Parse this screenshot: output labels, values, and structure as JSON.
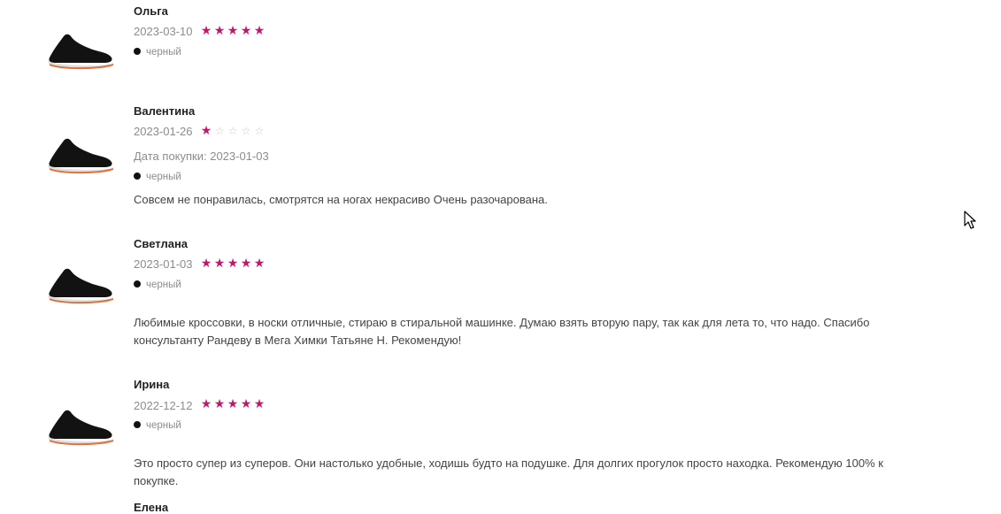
{
  "reviews": [
    {
      "name": "Ольга",
      "date": "2023-03-10",
      "rating": 5,
      "color_label": "черный"
    },
    {
      "name": "Валентина",
      "date": "2023-01-26",
      "rating": 1,
      "purchase_date": "Дата покупки: 2023-01-03",
      "color_label": "черный",
      "text": "Совсем не понравилась, смотрятся на ногах некрасиво Очень разочарована."
    },
    {
      "name": "Светлана",
      "date": "2023-01-03",
      "rating": 5,
      "color_label": "черный",
      "text": "Любимые кроссовки, в носки отличные, стираю в стиральной машинке. Думаю взять вторую пару, так как для лета то, что надо. Спасибо консультанту Рандеву в Мега Химки Татьяне Н. Рекомендую!"
    },
    {
      "name": "Ирина",
      "date": "2022-12-12",
      "rating": 5,
      "color_label": "черный",
      "text": "Это просто супер из суперов. Они настолько удобные, ходишь будто на подушке. Для долгих прогулок просто находка. Рекомендую 100% к покупке."
    },
    {
      "name": "Елена"
    }
  ],
  "star_glyphs": {
    "filled": "★",
    "empty": "☆"
  },
  "colors": {
    "star_accent": "#c2186b",
    "star_empty": "#c9c9c9"
  },
  "icons": {
    "shoe_thumbnail": "black-sneaker-image",
    "swatch": "black-color-dot",
    "cursor": "mouse-pointer"
  }
}
